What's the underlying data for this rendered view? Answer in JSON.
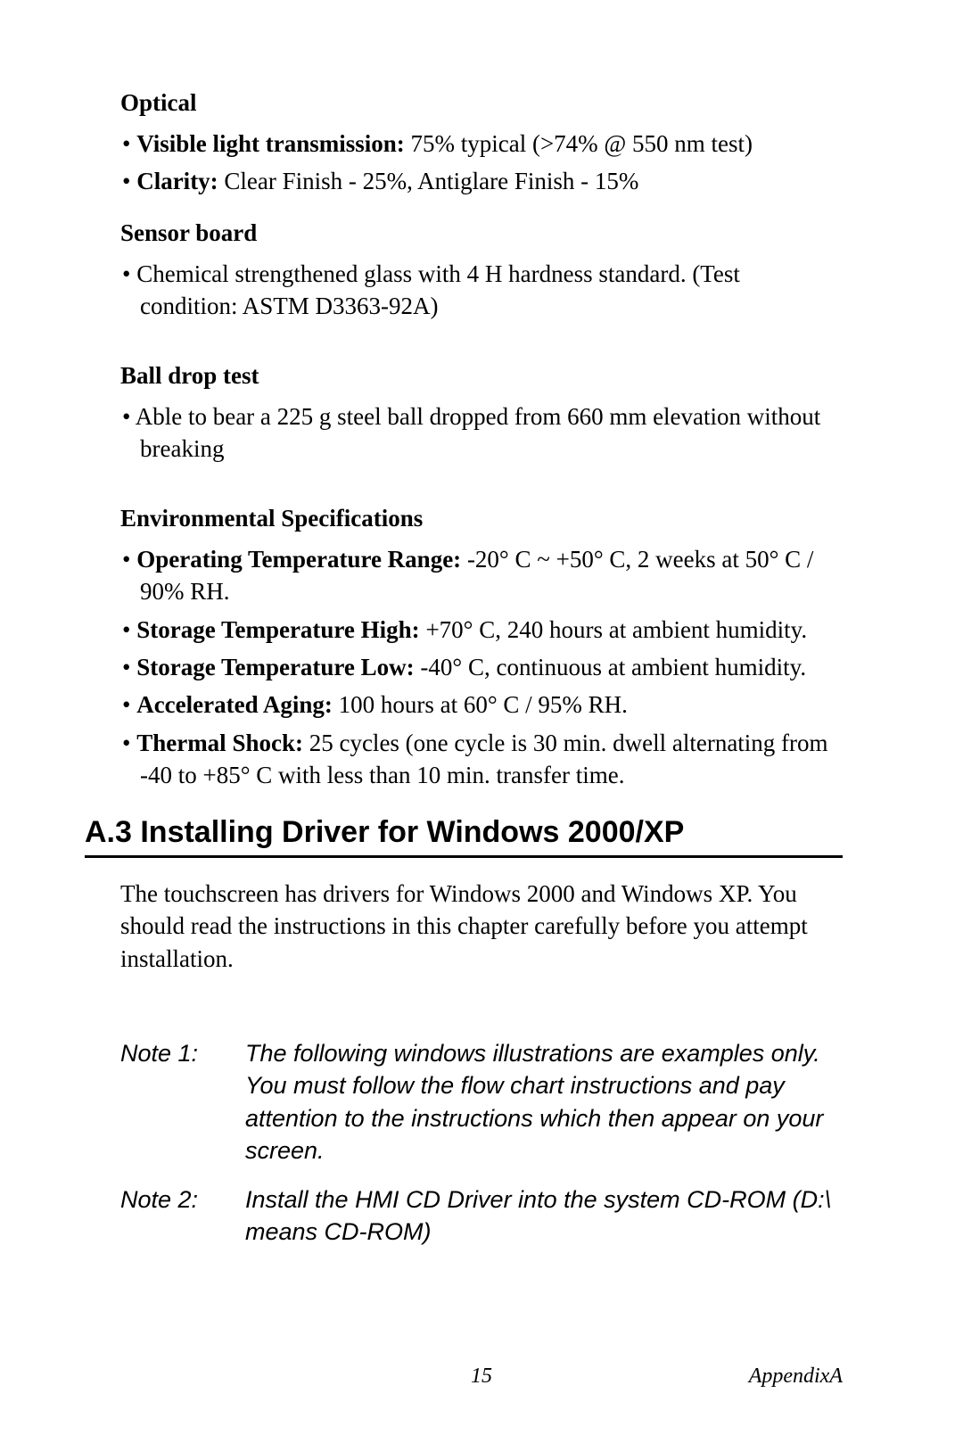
{
  "sections": {
    "optical": {
      "title": "Optical",
      "items": [
        {
          "label": "Visible light transmission:",
          "value": " 75% typical (>74% @ 550 nm test)"
        },
        {
          "label": "Clarity:",
          "value": " Clear Finish - 25%, Antiglare Finish - 15%"
        }
      ]
    },
    "sensor_board": {
      "title": "Sensor  board",
      "items": [
        {
          "label": "",
          "value": "Chemical strengthened glass with 4 H hardness standard. (Test condition: ASTM D3363-92A)"
        }
      ]
    },
    "ball_drop": {
      "title": "Ball  drop  test",
      "items": [
        {
          "label": "",
          "value": "Able to bear a 225 g steel ball dropped from 660 mm elevation without breaking"
        }
      ]
    },
    "env_specs": {
      "title": "Environmental Specifications",
      "items": [
        {
          "label": "Operating Temperature Range:",
          "value": " -20°  C ~ +50° C, 2 weeks at 50° C / 90% RH."
        },
        {
          "label": "Storage Temperature High:",
          "value": " +70° C, 240 hours at ambient humidity."
        },
        {
          "label": "Storage Temperature Low:",
          "value": " -40° C, continuous at ambient humidity."
        },
        {
          "label": "Accelerated Aging:",
          "value": " 100 hours at 60° C / 95% RH."
        },
        {
          "label": "Thermal Shock:",
          "value": " 25 cycles (one cycle is 30 min. dwell alternating from -40 to +85° C with less than 10 min. transfer time."
        }
      ]
    }
  },
  "heading": "A.3  Installing Driver for Windows 2000/XP",
  "paragraph": "The touchscreen has drivers for Windows 2000 and Windows XP. You should read the instructions in this chapter carefully before you attempt installation.",
  "notes": [
    {
      "label": "Note 1:",
      "body": "The following windows illustrations are examples only. You must follow the flow chart instructions and pay attention to the instructions which then appear on your screen."
    },
    {
      "label": "Note 2:",
      "body": "Install the HMI CD Driver into the system CD-ROM (D:\\ means CD-ROM)"
    }
  ],
  "footer": {
    "page": "15",
    "section": "AppendixA"
  }
}
